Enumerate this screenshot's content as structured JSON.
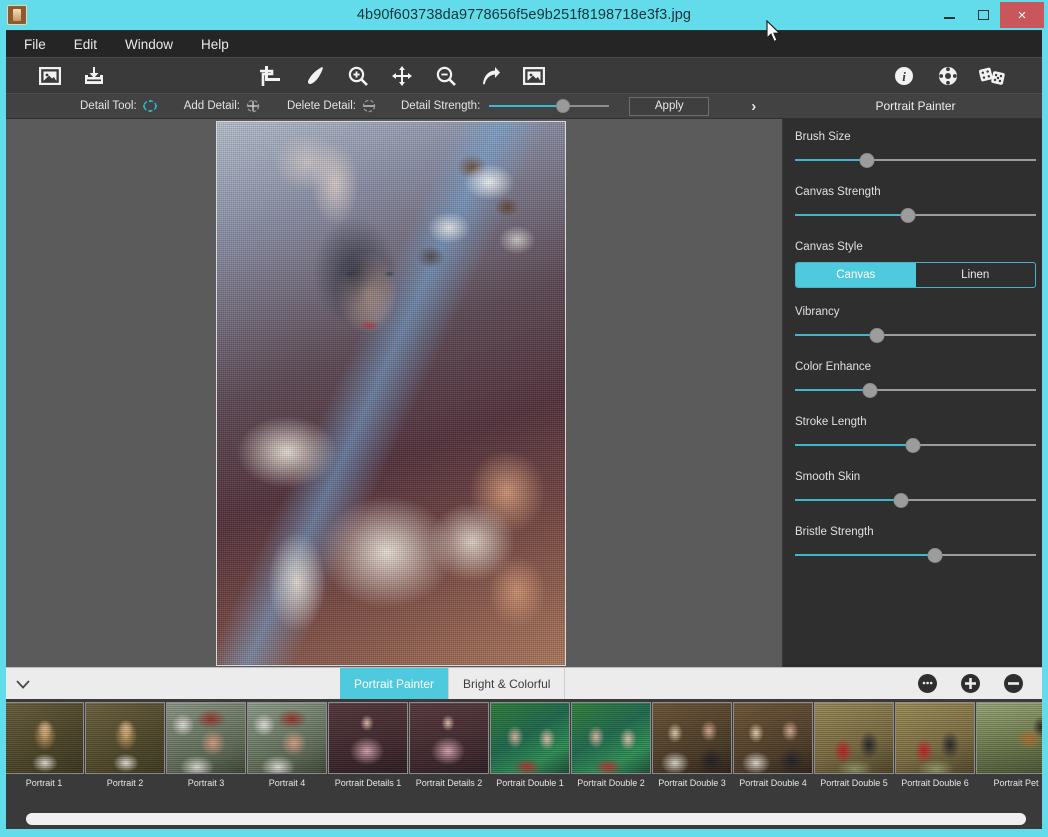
{
  "window": {
    "title": "4b90f603738da9778656f5e9b251f8198718e3f3.jpg",
    "app_icon": "app-icon",
    "minimize_label": "–",
    "maximize_label": "□",
    "close_label": "×",
    "accent_color": "#62dcea",
    "close_color": "#c9565a"
  },
  "menu": {
    "items": [
      {
        "label": "File"
      },
      {
        "label": "Edit"
      },
      {
        "label": "Window"
      },
      {
        "label": "Help"
      }
    ]
  },
  "toolbar": {
    "left_buttons": [
      {
        "name": "open-image-icon"
      },
      {
        "name": "save-image-icon"
      }
    ],
    "center_buttons": [
      {
        "name": "crop-icon"
      },
      {
        "name": "brush-icon"
      },
      {
        "name": "zoom-in-icon"
      },
      {
        "name": "pan-move-icon"
      },
      {
        "name": "zoom-out-icon"
      },
      {
        "name": "redo-arrow-icon"
      },
      {
        "name": "compare-image-icon"
      }
    ],
    "right_buttons": [
      {
        "name": "info-icon"
      },
      {
        "name": "settings-icon"
      },
      {
        "name": "dice-icon"
      }
    ]
  },
  "options_bar": {
    "detail_tool_label": "Detail Tool:",
    "add_detail_label": "Add Detail:",
    "delete_detail_label": "Delete Detail:",
    "detail_strength_label": "Detail Strength:",
    "detail_strength_value": 62,
    "apply_label": "Apply",
    "next_chevron": "›",
    "preset_name": "Portrait Painter"
  },
  "right_panel": {
    "controls": [
      {
        "type": "slider",
        "label": "Brush Size",
        "value": 30
      },
      {
        "type": "slider",
        "label": "Canvas Strength",
        "value": 47
      },
      {
        "type": "segment",
        "label": "Canvas Style",
        "options": [
          "Canvas",
          "Linen"
        ],
        "selected": "Canvas"
      },
      {
        "type": "slider",
        "label": "Vibrancy",
        "value": 34
      },
      {
        "type": "slider",
        "label": "Color Enhance",
        "value": 31
      },
      {
        "type": "slider",
        "label": "Stroke Length",
        "value": 49
      },
      {
        "type": "slider",
        "label": "Smooth Skin",
        "value": 44
      },
      {
        "type": "slider",
        "label": "Bristle Strength",
        "value": 58
      }
    ]
  },
  "filmstrip_bar": {
    "collapse_icon": "chevron-down-icon",
    "tabs": [
      {
        "label": "Portrait Painter",
        "active": true
      },
      {
        "label": "Bright & Colorful",
        "active": false
      }
    ],
    "actions": [
      {
        "name": "edit-preset-icon"
      },
      {
        "name": "add-preset-icon"
      },
      {
        "name": "remove-preset-icon"
      }
    ]
  },
  "thumbnails": [
    {
      "label": "Portrait 1",
      "style": "p1"
    },
    {
      "label": "Portrait 2",
      "style": "p2"
    },
    {
      "label": "Portrait 3",
      "style": "p3"
    },
    {
      "label": "Portrait 4",
      "style": "p4"
    },
    {
      "label": "Portrait Details 1",
      "style": "pd1"
    },
    {
      "label": "Portrait Details 2",
      "style": "pd2"
    },
    {
      "label": "Portrait Double 1",
      "style": "pdb1"
    },
    {
      "label": "Portrait Double 2",
      "style": "pdb2"
    },
    {
      "label": "Portrait Double 3",
      "style": "pdb3"
    },
    {
      "label": "Portrait Double 4",
      "style": "pdb4"
    },
    {
      "label": "Portrait Double 5",
      "style": "pdb5"
    },
    {
      "label": "Portrait Double 6",
      "style": "pdb6"
    },
    {
      "label": "Portrait Pet",
      "style": "ppet"
    }
  ]
}
